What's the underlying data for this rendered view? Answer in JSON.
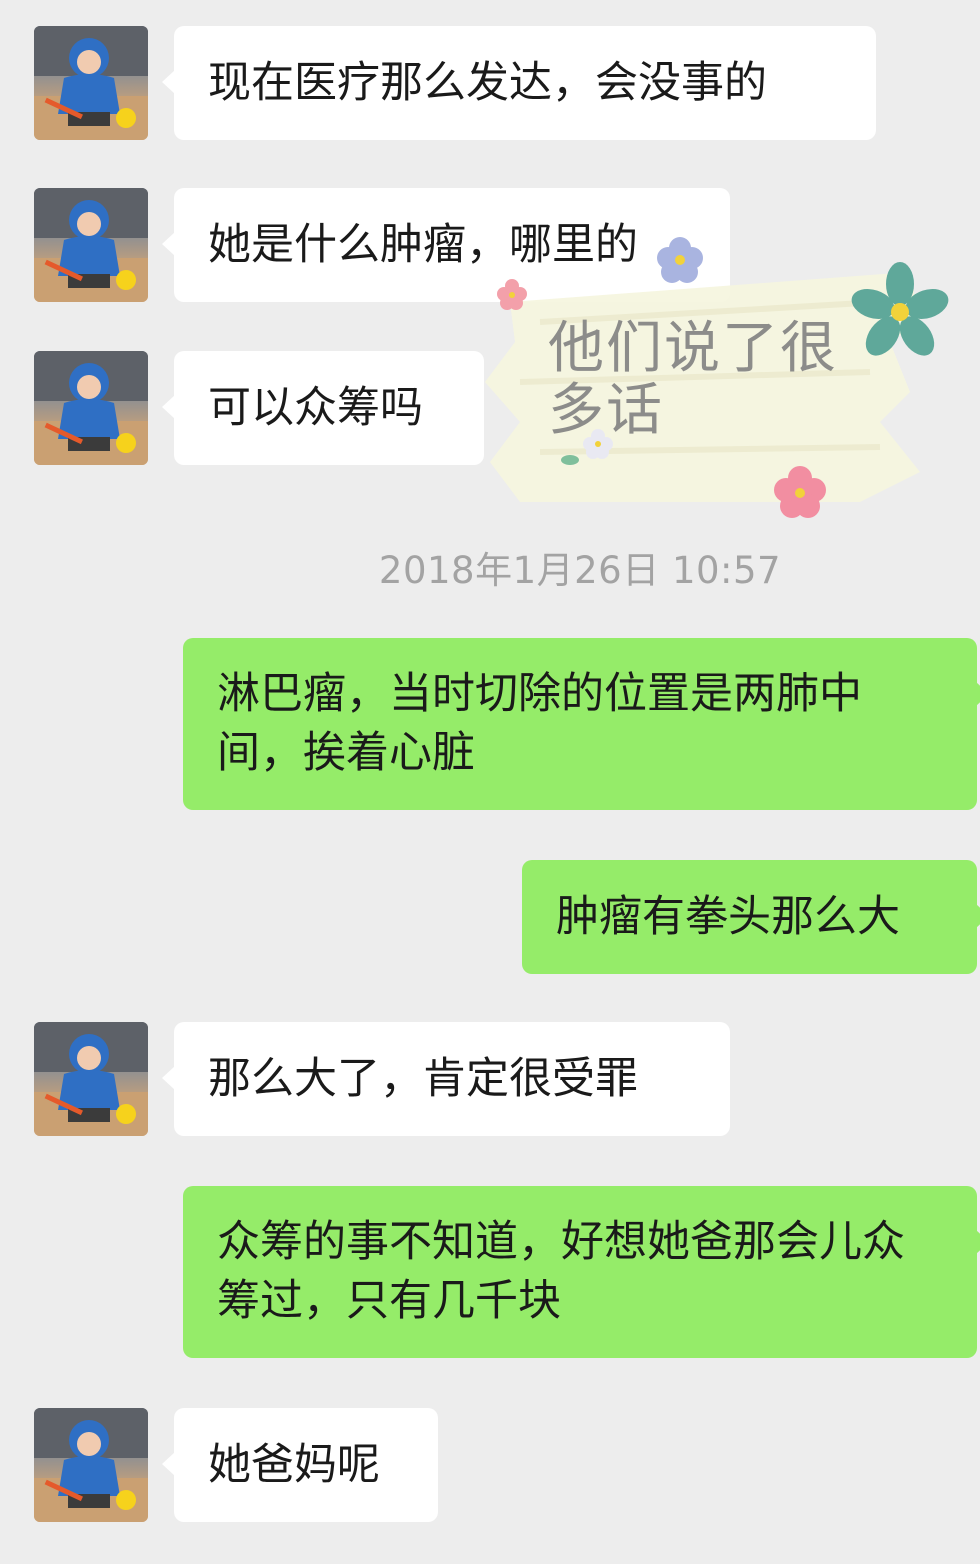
{
  "chat": {
    "messages": [
      {
        "side": "left",
        "text": "现在医疗那么发达，会没事的"
      },
      {
        "side": "left",
        "text": "她是什么肿瘤，哪里的"
      },
      {
        "side": "left",
        "text": "可以众筹吗"
      },
      {
        "side": "right",
        "text": "淋巴瘤，当时切除的位置是两肺中间，挨着心脏"
      },
      {
        "side": "right",
        "text": "肿瘤有拳头那么大"
      },
      {
        "side": "left",
        "text": "那么大了，肯定很受罪"
      },
      {
        "side": "right",
        "text": "众筹的事不知道，好想她爸那会儿众筹过，只有几千块"
      },
      {
        "side": "left",
        "text": "她爸妈呢"
      }
    ],
    "timestamp": "2018年1月26日 10:57"
  },
  "sticker": {
    "text": "他们说了很多话",
    "icon": "flower-sticker"
  },
  "colors": {
    "background": "#ededed",
    "incoming_bubble": "#ffffff",
    "outgoing_bubble": "#95ec69",
    "timestamp": "#a3a3a3"
  }
}
